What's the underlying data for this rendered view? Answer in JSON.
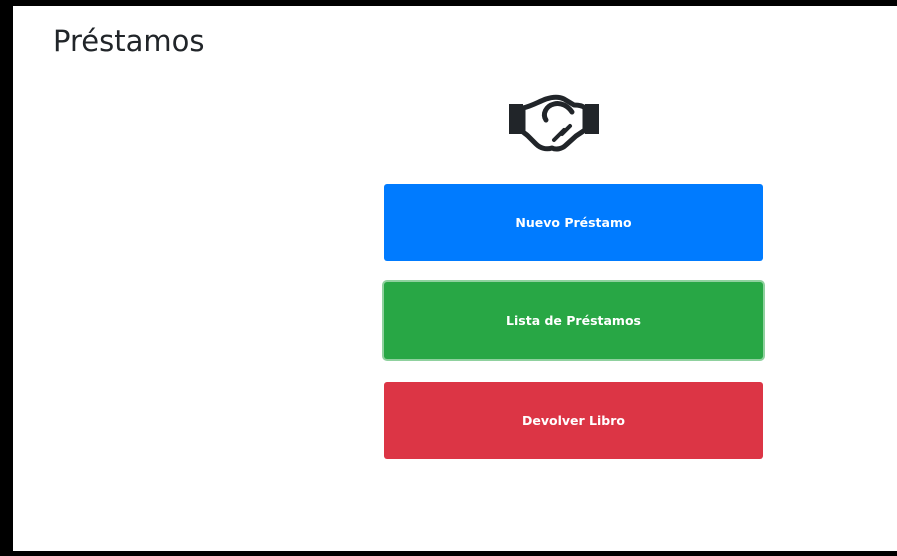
{
  "page": {
    "title": "Préstamos"
  },
  "hero": {
    "icon": "handshake-icon"
  },
  "actions": [
    {
      "label": "Nuevo Préstamo",
      "color": "#007bff",
      "state": "default"
    },
    {
      "label": "Lista de Préstamos",
      "color": "#28a745",
      "state": "focused"
    },
    {
      "label": "Devolver Libro",
      "color": "#dc3545",
      "state": "default"
    }
  ]
}
